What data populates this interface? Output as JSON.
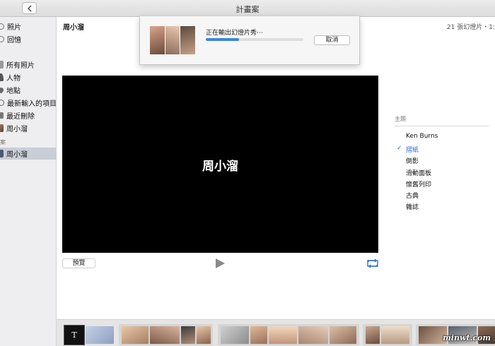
{
  "window": {
    "title": "計畫案"
  },
  "sidebar": {
    "items_top": [
      {
        "label": "照片",
        "icon": "photos-icon"
      },
      {
        "label": "回憶",
        "icon": "memories-icon"
      }
    ],
    "items_library": [
      {
        "label": "所有照片",
        "icon": "all-photos-icon"
      },
      {
        "label": "人物",
        "icon": "people-icon"
      },
      {
        "label": "地點",
        "icon": "places-icon"
      },
      {
        "label": "最新輸入的項目",
        "icon": "recent-imports-icon"
      },
      {
        "label": "最近刪除",
        "icon": "trash-icon"
      },
      {
        "label": "周小溜",
        "icon": "album-icon"
      }
    ],
    "section_label": "案",
    "items_projects": [
      {
        "label": "周小溜",
        "icon": "slideshow-icon",
        "selected": true
      }
    ]
  },
  "project": {
    "title": "周小溜",
    "info": "21 張幻燈片・1:"
  },
  "export_dialog": {
    "message": "正在輸出幻燈片秀⋯",
    "progress": 0.34,
    "cancel_label": "取消"
  },
  "preview": {
    "slide_title": "周小溜",
    "preview_button_label": "預覽"
  },
  "themes": {
    "header": "主題",
    "items": [
      "Ken Burns",
      "摺紙",
      "倒影",
      "滑動面板",
      "懷舊列印",
      "古典",
      "雜誌"
    ],
    "selected_index": 1
  },
  "filmstrip": {
    "title_slide_label": "T",
    "watermark": "minwt.com"
  },
  "colors": {
    "accent": "#2f6fd6",
    "progress": "#3a86de",
    "sidebar_bg": "#eeedef",
    "preview_bg": "#000000"
  }
}
